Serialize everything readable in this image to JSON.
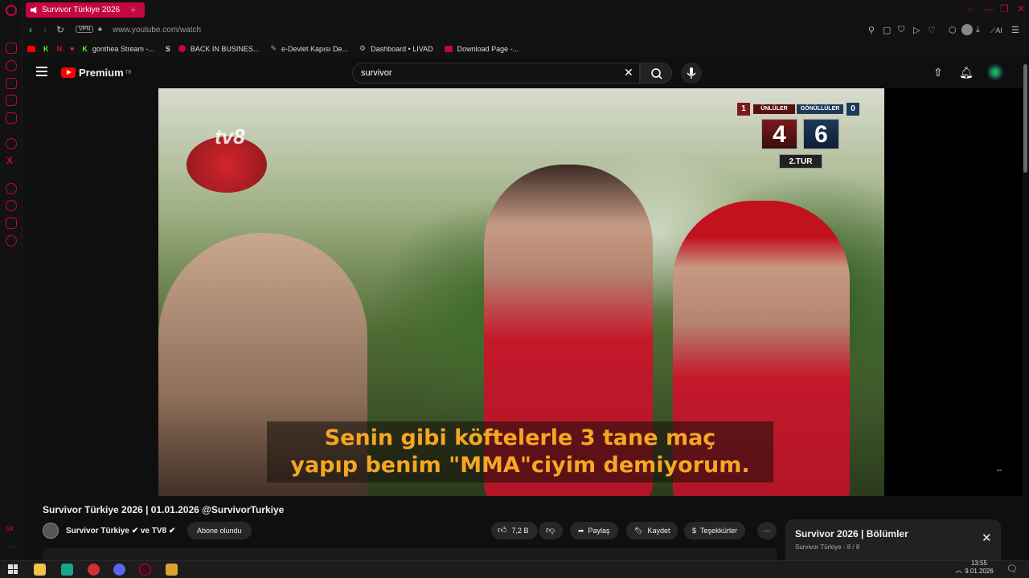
{
  "browser": {
    "tab_title": "Survivor Türkiye 2026",
    "new_tab": "+",
    "vpn": "VPN",
    "url": "www.youtube.com/watch",
    "ai_label": "AI",
    "bookmarks": [
      "gonthea Stream -...",
      "BACK IN BUSINES...",
      "e-Devlet Kapısı De...",
      "Dashboard • LIVAD",
      "Download Page -..."
    ],
    "bookmark_colors": [
      "#2e7d32",
      "#c3073f",
      "#aaaaaa",
      "#aaaaaa",
      "#c3073f"
    ]
  },
  "youtube": {
    "logo": "Premium",
    "logo_country": "TR",
    "search_value": "survivor"
  },
  "video": {
    "watermark": "tv8",
    "score_left_label": "ÜNLÜLER",
    "score_right_label": "GÖNÜLLÜLER",
    "score_left_small": "1",
    "score_right_small": "0",
    "score_left": "4",
    "score_right": "6",
    "round": "2.TUR",
    "subtitle_line1": "Senin gibi köftelerle 3 tane maç",
    "subtitle_line2": "yapıp benim \"MMA\"ciyim demiyorum."
  },
  "watch": {
    "title": "Survivor Türkiye 2026 | 01.01.2026 @SurvivorTurkiye",
    "channel": "Survivor Türkiye ✔ ve TV8 ✔",
    "subscribe": "Abone olundu",
    "likes": "7,2 B",
    "share": "Paylaş",
    "save": "Kaydet",
    "thanks": "Teşekkürler",
    "more": "⋯"
  },
  "playlist": {
    "title": "Survivor 2026 | Bölümler",
    "subtitle": "Survivor Türkiye - 8 / 8"
  },
  "taskbar": {
    "time": "13:55",
    "date": "9.01.2026"
  }
}
